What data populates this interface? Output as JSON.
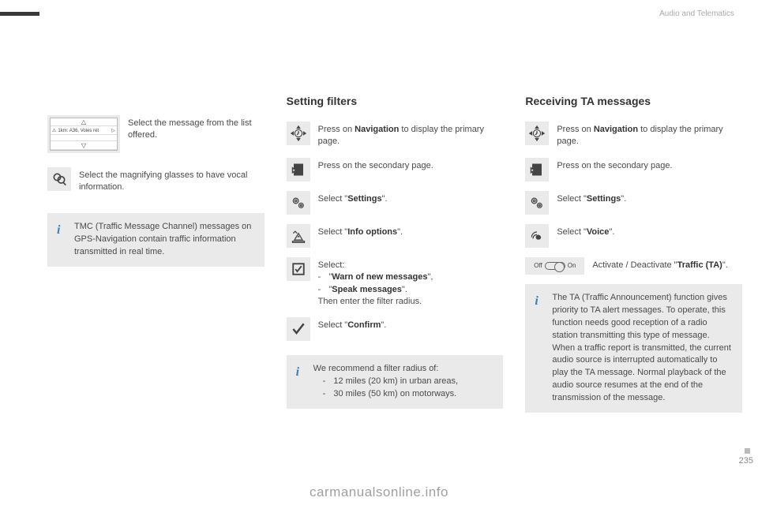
{
  "header": {
    "section": "Audio and Telematics"
  },
  "col1": {
    "msg_list_label": "1km: A36, Voies rét",
    "select_message": "Select the message from the list offered.",
    "magnify": "Select the magnifying glasses to have vocal information.",
    "tmc_info": "TMC (Traffic Message Channel) messages on GPS-Navigation contain traffic information transmitted in real time."
  },
  "col2": {
    "heading": "Setting filters",
    "r1_pre": "Press on ",
    "r1_bold": "Navigation",
    "r1_post": " to display the primary page.",
    "r2": "Press on the secondary page.",
    "r3_pre": "Select \"",
    "r3_bold": "Settings",
    "r3_post": "\".",
    "r4_pre": "Select \"",
    "r4_bold": "Info options",
    "r4_post": "\".",
    "r5_intro": "Select:",
    "r5_opt1_pre": "\"",
    "r5_opt1_bold": "Warn of new messages",
    "r5_opt1_post": "\",",
    "r5_opt2_pre": "\"",
    "r5_opt2_bold": "Speak messages",
    "r5_opt2_post": "\".",
    "r5_then": "Then enter the filter radius.",
    "r6_pre": "Select \"",
    "r6_bold": "Confirm",
    "r6_post": "\".",
    "rec_intro": "We recommend a filter radius of:",
    "rec1": "12 miles (20 km) in urban areas,",
    "rec2": "30 miles (50 km) on motorways."
  },
  "col3": {
    "heading": "Receiving TA messages",
    "r1_pre": "Press on ",
    "r1_bold": "Navigation",
    "r1_post": " to display the primary page.",
    "r2": "Press on the secondary page.",
    "r3_pre": "Select \"",
    "r3_bold": "Settings",
    "r3_post": "\".",
    "r4_pre": "Select \"",
    "r4_bold": "Voice",
    "r4_post": "\".",
    "toggle_off": "Off",
    "toggle_on": "On",
    "r5_pre": "Activate / Deactivate \"",
    "r5_bold": "Traffic (TA)",
    "r5_post": "\".",
    "ta_info": "The TA (Traffic Announcement) function gives priority to TA alert messages. To operate, this function needs good reception of a radio station transmitting this type of message. When a traffic report is transmitted, the current audio source is interrupted automatically to play the TA message. Normal playback of the audio source resumes at the end of the transmission of the message."
  },
  "watermark": "carmanualsonline.info",
  "page_num": "235"
}
